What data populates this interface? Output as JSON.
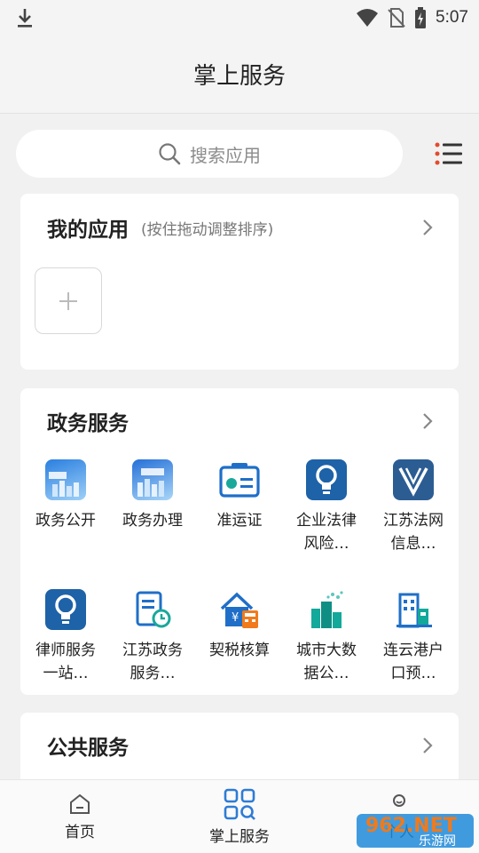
{
  "status_bar": {
    "time": "5:07"
  },
  "header": {
    "title": "掌上服务"
  },
  "search": {
    "placeholder": "搜索应用"
  },
  "my_apps": {
    "title": "我的应用",
    "hint": "(按住拖动调整排序)",
    "add_symbol": "+"
  },
  "gov_services": {
    "title": "政务服务",
    "items": [
      {
        "label": "政务公开",
        "icon": "gov-open-icon"
      },
      {
        "label": "政务办理",
        "icon": "gov-handle-icon"
      },
      {
        "label": "准运证",
        "icon": "permit-card-icon"
      },
      {
        "label": "企业法律风险…",
        "icon": "lightbulb-icon"
      },
      {
        "label": "江苏法网信息…",
        "icon": "law-v-icon"
      },
      {
        "label": "律师服务一站…",
        "icon": "lightbulb-icon"
      },
      {
        "label": "江苏政务服务…",
        "icon": "document-clock-icon"
      },
      {
        "label": "契税核算",
        "icon": "house-calculator-icon"
      },
      {
        "label": "城市大数据公…",
        "icon": "city-data-icon"
      },
      {
        "label": "连云港户口预…",
        "icon": "building-icon"
      }
    ]
  },
  "public_services": {
    "title": "公共服务"
  },
  "tabbar": {
    "tabs": [
      {
        "label": "首页",
        "icon": "home-icon",
        "active": false
      },
      {
        "label": "掌上服务",
        "icon": "grid-search-icon",
        "active": true
      },
      {
        "label": "个人",
        "icon": "person-icon",
        "active": false
      }
    ]
  },
  "watermark": {
    "text_top": "962.NET",
    "text_bottom": "乐游网"
  },
  "colors": {
    "accent": "#2e7bd6",
    "brand_orange": "#f07a1c",
    "teal": "#12a89a"
  }
}
